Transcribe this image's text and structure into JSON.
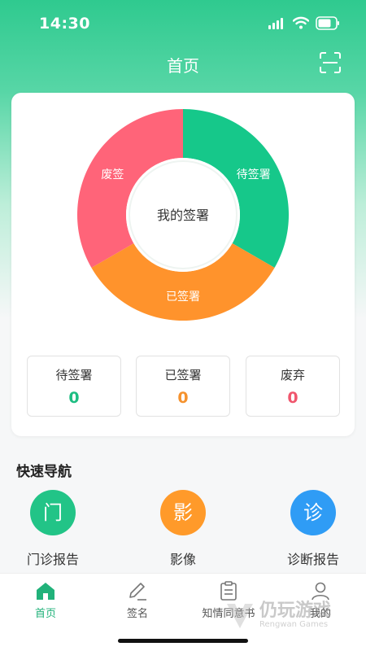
{
  "status_bar": {
    "time": "14:30"
  },
  "header": {
    "title": "首页",
    "scan_icon": "scan-icon"
  },
  "chart_data": {
    "type": "pie",
    "center_label": "我的签署",
    "slices": [
      {
        "label": "待签署",
        "value": 1,
        "color": "#16c88a"
      },
      {
        "label": "已签署",
        "value": 1,
        "color": "#ff932c"
      },
      {
        "label": "废签",
        "value": 1,
        "color": "#ff6479"
      }
    ]
  },
  "stats": [
    {
      "label": "待签署",
      "value": "0",
      "color": "#1dbd82"
    },
    {
      "label": "已签署",
      "value": "0",
      "color": "#f5922e"
    },
    {
      "label": "废弃",
      "value": "0",
      "color": "#f0566d"
    }
  ],
  "quick_nav": {
    "title": "快速导航",
    "items": [
      {
        "glyph": "门",
        "label": "门诊报告",
        "color": "#22c487"
      },
      {
        "glyph": "影",
        "label": "影像",
        "color": "#ff9a2a"
      },
      {
        "glyph": "诊",
        "label": "诊断报告",
        "color": "#2f9cf5"
      }
    ]
  },
  "tabbar": {
    "items": [
      {
        "label": "首页",
        "icon": "home-icon",
        "active": true
      },
      {
        "label": "签名",
        "icon": "pen-icon",
        "active": false
      },
      {
        "label": "知情同意书",
        "icon": "clipboard-icon",
        "active": false
      },
      {
        "label": "我的",
        "icon": "user-icon",
        "active": false
      }
    ]
  },
  "watermark": {
    "text": "仍玩游戏",
    "sub": "Rengwan Games"
  }
}
